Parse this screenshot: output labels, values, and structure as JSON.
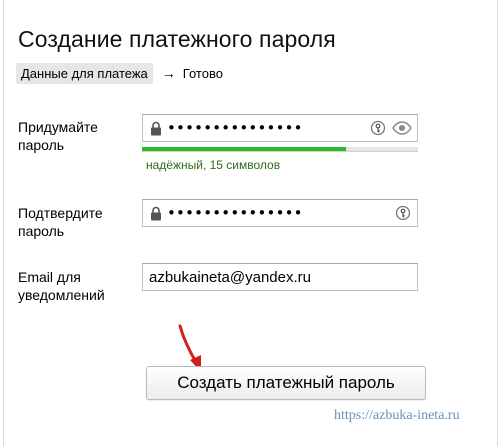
{
  "page": {
    "title": "Создание платежного пароля"
  },
  "breadcrumb": {
    "active": "Данные для платежа",
    "arrow": "→",
    "next": "Готово"
  },
  "form": {
    "password": {
      "label": "Придумайте пароль",
      "value": "•••••••••••••••",
      "strength_text": "надёжный, 15 символов",
      "strength_fraction": 0.74
    },
    "confirm": {
      "label": "Подтвердите пароль",
      "value": "•••••••••••••••"
    },
    "email": {
      "label": "Email для уведомлений",
      "value": "azbukaineta@yandex.ru"
    },
    "submit_label": "Создать платежный пароль"
  },
  "watermark": "https://azbuka-ineta.ru",
  "icons": {
    "lock": "lock-icon",
    "key": "key-icon",
    "eye": "eye-icon",
    "arrow": "red-arrow-icon"
  },
  "colors": {
    "strength_fill": "#2dbb2d",
    "strength_text": "#2d6b1e",
    "arrow": "#d11f1f",
    "watermark": "#6b8fb5"
  }
}
